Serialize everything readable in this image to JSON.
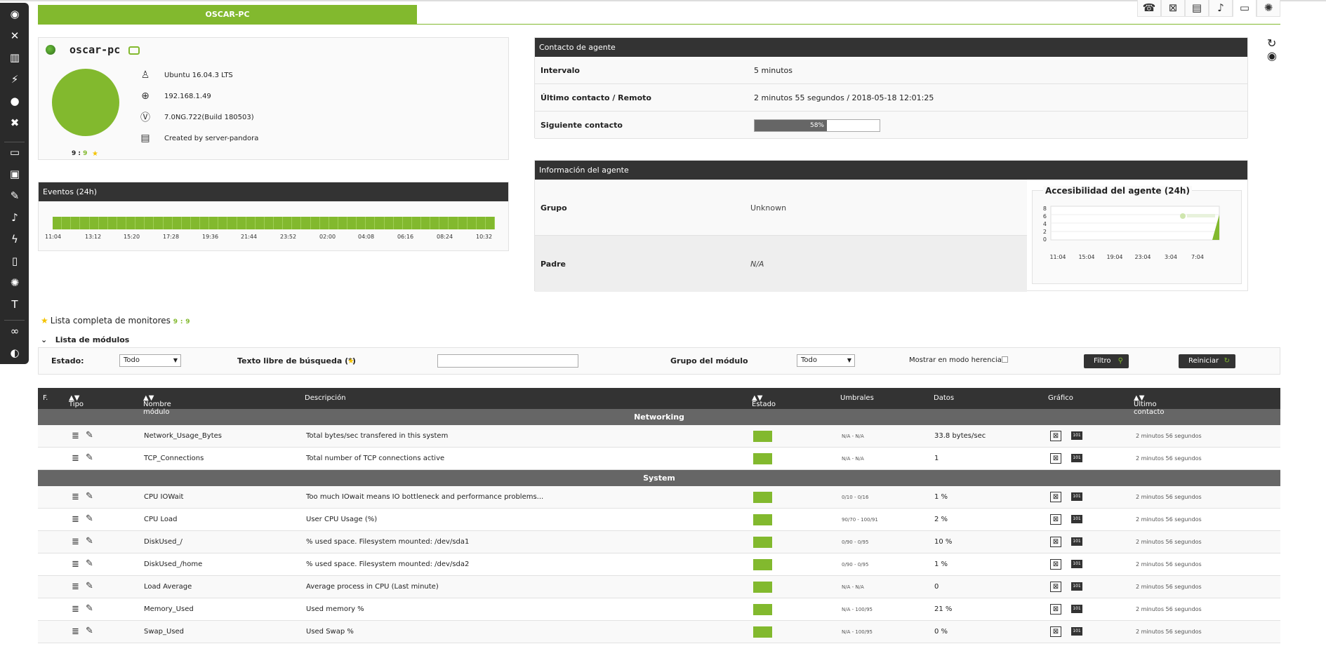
{
  "header": {
    "tab_title": "OSCAR-PC",
    "icons": [
      "signal-icon",
      "graph-icon",
      "inventory-icon",
      "alert-icon",
      "plug-icon",
      "gear-icon"
    ]
  },
  "sidebar": {
    "icons": [
      "dashboard-icon",
      "network-icon",
      "reports-icon",
      "events-icon",
      "users-icon",
      "tools-icon",
      "agent-icon",
      "contacts-icon",
      "wrench-icon",
      "bell-icon",
      "bolt-icon",
      "server-icon",
      "settings-icon",
      "hammer-icon",
      "link-icon",
      "pandora-logo-icon"
    ]
  },
  "agent": {
    "name": "oscar-pc",
    "os": "Ubuntu 16.04.3 LTS",
    "ip": "192.168.1.49",
    "version": "7.0NG.722(Build 180503)",
    "created_by": "Created by server-pandora",
    "score_a": "9",
    "score_sep": ":",
    "score_b": "9"
  },
  "events": {
    "title": "Eventos (24h)",
    "ticks": [
      "11:04",
      "13:12",
      "15:20",
      "17:28",
      "19:36",
      "21:44",
      "23:52",
      "02:00",
      "04:08",
      "06:16",
      "08:24",
      "10:32"
    ]
  },
  "contact": {
    "title": "Contacto de agente",
    "interval_label": "Intervalo",
    "interval_value": "5 minutos",
    "last_label": "Último contacto / Remoto",
    "last_value": "2 minutos 55 segundos / 2018-05-18 12:01:25",
    "next_label": "Siguiente contacto",
    "next_progress_text": "58%",
    "next_progress": 0.58
  },
  "info": {
    "title": "Información del agente",
    "group_label": "Grupo",
    "group_value": "Unknown",
    "parent_label": "Padre",
    "parent_value": "N/A",
    "access_title": "Accesibilidad del agente (24h)",
    "access_y_ticks": [
      "8",
      "6",
      "4",
      "2",
      "0"
    ],
    "access_x_ticks": [
      "11:04",
      "15:04",
      "19:04",
      "23:04",
      "3:04",
      "7:04"
    ]
  },
  "monitors": {
    "title": "Lista completa de monitores",
    "count_a": "9",
    "count_sep": ":",
    "count_b": "9",
    "list_label": "Lista de módulos"
  },
  "filter": {
    "estado_label": "Estado:",
    "estado_value": "Todo",
    "search_label": "Texto libre de búsqueda (*)",
    "search_value": "",
    "group_label": "Grupo del módulo",
    "group_value": "Todo",
    "inherit_label": "Mostrar en modo herencia",
    "filter_btn": "Filtro",
    "reset_btn": "Reiniciar"
  },
  "table": {
    "headers": {
      "f": "F.",
      "tipo": "Tipo",
      "nombre": "Nombre módulo",
      "desc": "Descripción",
      "estado": "Estado",
      "umbrales": "Umbrales",
      "datos": "Datos",
      "grafico": "Gráfico",
      "ultimo": "Último contacto"
    },
    "group1": "Networking",
    "group2": "System",
    "rows": [
      {
        "name": "Network_Usage_Bytes",
        "desc": "Total bytes/sec transfered in this system",
        "thr": "N/A - N/A",
        "data": "33.8 bytes/sec",
        "last": "2 minutos 56 segundos"
      },
      {
        "name": "TCP_Connections",
        "desc": "Total number of TCP connections active",
        "thr": "N/A - N/A",
        "data": "1",
        "last": "2 minutos 56 segundos"
      },
      {
        "name": "CPU IOWait",
        "desc": "Too much IOwait means IO bottleneck and performance problems...",
        "thr": "0/10 - 0/16",
        "data": "1 %",
        "last": "2 minutos 56 segundos"
      },
      {
        "name": "CPU Load",
        "desc": "User CPU Usage (%)",
        "thr": "90/70 - 100/91",
        "data": "2 %",
        "last": "2 minutos 56 segundos"
      },
      {
        "name": "DiskUsed_/",
        "desc": "% used space. Filesystem mounted: /dev/sda1",
        "thr": "0/90 - 0/95",
        "data": "10 %",
        "last": "2 minutos 56 segundos"
      },
      {
        "name": "DiskUsed_/home",
        "desc": "% used space. Filesystem mounted: /dev/sda2",
        "thr": "0/90 - 0/95",
        "data": "1 %",
        "last": "2 minutos 56 segundos"
      },
      {
        "name": "Load Average",
        "desc": "Average process in CPU (Last minute)",
        "thr": "N/A - N/A",
        "data": "0",
        "last": "2 minutos 56 segundos"
      },
      {
        "name": "Memory_Used",
        "desc": "Used memory %",
        "thr": "N/A - 100/95",
        "data": "21 %",
        "last": "2 minutos 56 segundos"
      },
      {
        "name": "Swap_Used",
        "desc": "Used Swap %",
        "thr": "N/A - 100/95",
        "data": "0 %",
        "last": "2 minutos 56 segundos"
      }
    ]
  },
  "colors": {
    "accent": "#82b92e",
    "dark": "#333333",
    "group_row": "#666666"
  }
}
